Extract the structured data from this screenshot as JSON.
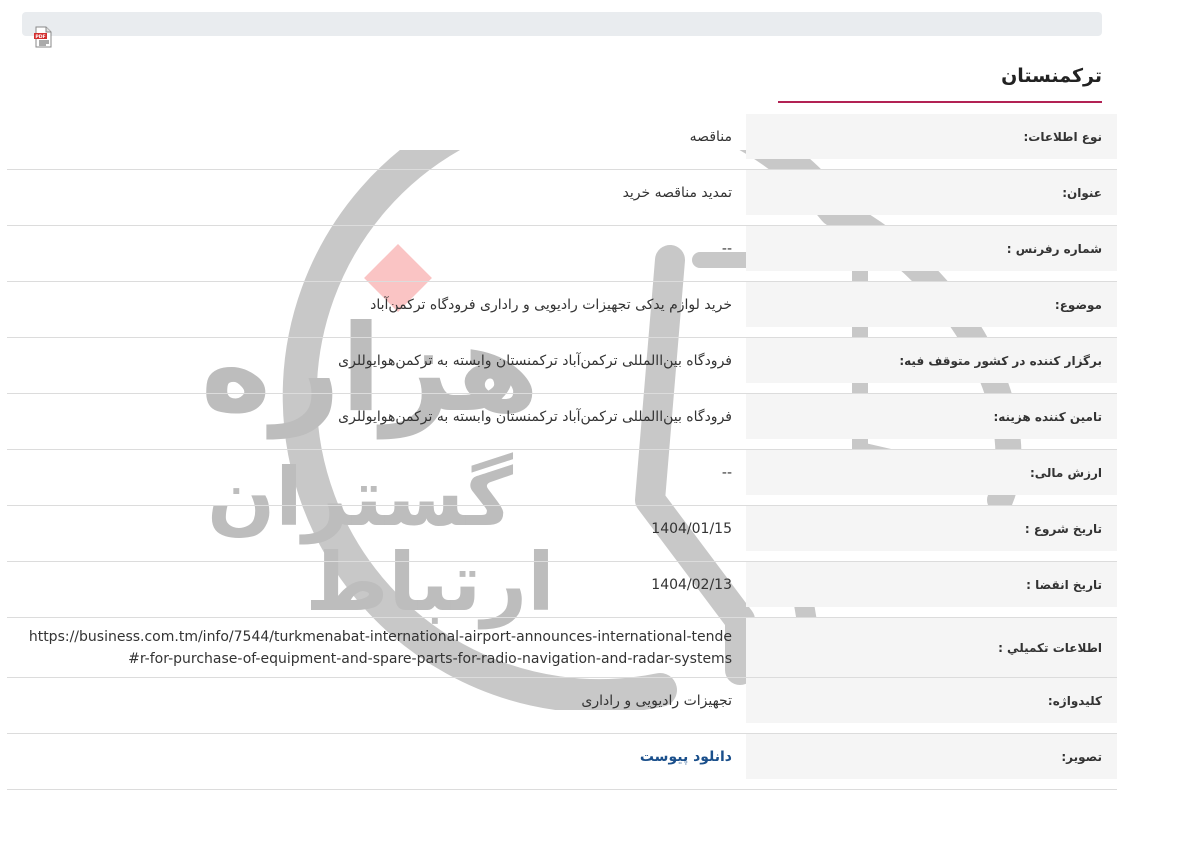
{
  "page": {
    "title": "ترکمنستان"
  },
  "toolbar": {
    "pdf_icon": "pdf-file-icon"
  },
  "watermark": {
    "line1": "ارتباط",
    "line2": "گستران",
    "line3": "هزاره"
  },
  "rows": [
    {
      "label": "نوع اطلاعات:",
      "value": "مناقصه"
    },
    {
      "label": "عنوان:",
      "value": "تمدید مناقصه خرید"
    },
    {
      "label": "شماره رفرنس :",
      "value": "--"
    },
    {
      "label": "موضوع:",
      "value": "خرید لوازم یدکی تجهیزات رادیویی و راداری فرودگاه ترکمن‌آباد"
    },
    {
      "label": "برگزار کننده در کشور متوقف فیه:",
      "value": "فرودگاه بین‌االمللی ترکمن‌آباد ترکمنستان وابسته به ترکمن‌هوایوللری"
    },
    {
      "label": "تامین کننده هزینه:",
      "value": "فرودگاه بین‌االمللی ترکمن‌آباد ترکمنستان وابسته به ترکمن‌هوایوللری"
    },
    {
      "label": "ارزش مالی:",
      "value": "--"
    },
    {
      "label": "تاریخ شروع :",
      "value": "1404/01/15"
    },
    {
      "label": "تاریخ انقضا :",
      "value": "1404/02/13"
    },
    {
      "label": "اطلاعات تکمیلي :",
      "value": "https://business.com.tm/info/7544/turkmenabat-international-airport-announces-international-tender-for-purchase-of-equipment-and-spare-parts-for-radio-navigation-and-radar-systems#"
    },
    {
      "label": "کلیدواژه:",
      "value": "تجهیزات رادیویی و راداری"
    },
    {
      "label": "تصویر:",
      "value": "دانلود پیوست"
    }
  ]
}
